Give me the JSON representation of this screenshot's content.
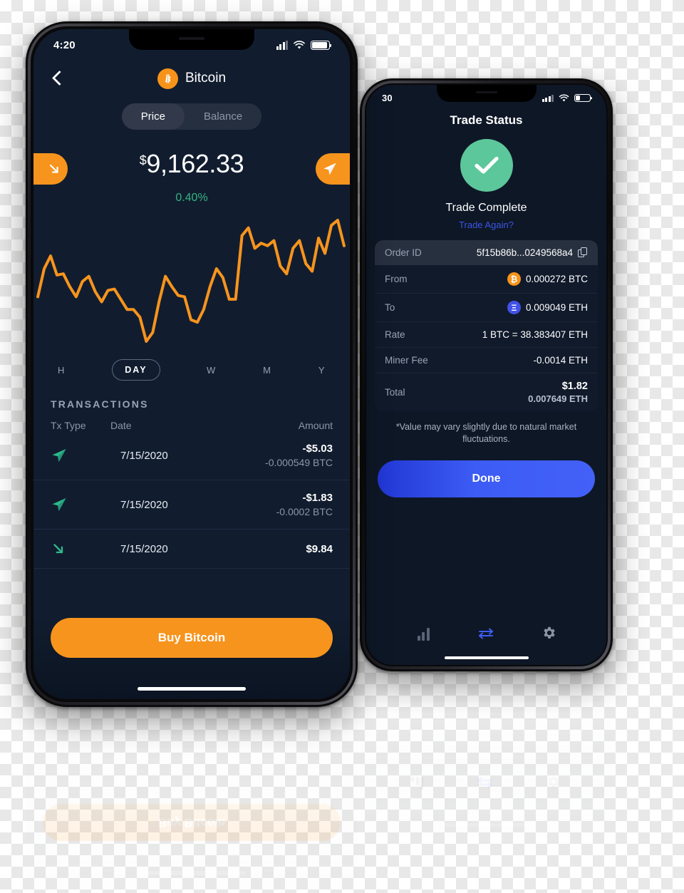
{
  "phone_front": {
    "status_bar": {
      "time": "4:20",
      "signal_icon": "signal-bars-icon",
      "wifi_icon": "wifi-icon",
      "battery_icon": "battery-icon",
      "battery_level_pct": 88
    },
    "nav": {
      "back_icon": "chevron-left-icon",
      "coin_icon": "bitcoin-icon",
      "coin_glyph": "₿",
      "title": "Bitcoin"
    },
    "segmented": {
      "option_price": "Price",
      "option_balance": "Balance",
      "selected": "Price"
    },
    "actions": {
      "receive_icon": "arrow-down-right-icon",
      "send_icon": "paper-plane-icon"
    },
    "price": {
      "currency_symbol": "$",
      "value": "9,162.33",
      "change": "0.40%",
      "change_color": "#34b57f"
    },
    "ranges": {
      "items": [
        "H",
        "DAY",
        "W",
        "M",
        "Y"
      ],
      "selected": "DAY"
    },
    "transactions": {
      "section_title": "TRANSACTIONS",
      "columns": [
        "Tx Type",
        "Date",
        "Amount"
      ],
      "rows": [
        {
          "type_icon": "paper-plane-icon",
          "direction": "sent",
          "date": "7/15/2020",
          "amount": "-$5.03",
          "crypto": "-0.000549 BTC"
        },
        {
          "type_icon": "paper-plane-icon",
          "direction": "sent",
          "date": "7/15/2020",
          "amount": "-$1.83",
          "crypto": "-0.0002 BTC"
        },
        {
          "type_icon": "arrow-down-right-icon",
          "direction": "received",
          "date": "7/15/2020",
          "amount": "$9.84",
          "crypto": ""
        }
      ]
    },
    "buy_button": "Buy Bitcoin",
    "accent_color": "#f7941d",
    "screen_bg": "#111d2f"
  },
  "phone_back": {
    "status_bar": {
      "time": "30",
      "signal_icon": "signal-bars-icon",
      "wifi_icon": "wifi-icon",
      "battery_icon": "battery-icon",
      "battery_level_pct": 35
    },
    "title": "Trade Status",
    "status_icon": "check-circle-icon",
    "status_color": "#5cc79a",
    "status_text": "Trade Complete",
    "trade_again_link": "Trade Again?",
    "details": [
      {
        "label": "Order ID",
        "value": "5f15b86b...0249568a4",
        "icon": "copy-icon",
        "highlight": true
      },
      {
        "label": "From",
        "value": "0.000272 BTC",
        "coin_icon": "bitcoin-icon",
        "coin_glyph": "₿"
      },
      {
        "label": "To",
        "value": "0.009049 ETH",
        "coin_icon": "ethereum-icon",
        "coin_glyph": "Ξ"
      },
      {
        "label": "Rate",
        "value": "1 BTC = 38.383407 ETH"
      },
      {
        "label": "Miner Fee",
        "value": "-0.0014 ETH"
      },
      {
        "label": "Total",
        "value": "$1.82",
        "sub_value": "0.007649 ETH"
      }
    ],
    "note": "*Value may vary slightly due to natural market fluctuations.",
    "done_button": "Done",
    "tab_bar": [
      {
        "icon": "bar-chart-icon",
        "active": false
      },
      {
        "icon": "exchange-arrows-icon",
        "active": true
      },
      {
        "icon": "gear-icon",
        "active": false
      }
    ],
    "accent_color": "#3d5cf5"
  },
  "chart_data": {
    "type": "line",
    "title": "",
    "xlabel": "",
    "ylabel": "",
    "line_color": "#f7941d",
    "grid": false,
    "legend": "none",
    "x": [
      0,
      1,
      2,
      3,
      4,
      5,
      6,
      7,
      8,
      9,
      10,
      11,
      12,
      13,
      14,
      15,
      16,
      17,
      18,
      19,
      20,
      21,
      22,
      23,
      24,
      25,
      26,
      27,
      28,
      29,
      30,
      31,
      32,
      33,
      34,
      35,
      36,
      37,
      38,
      39,
      40,
      41,
      42
    ],
    "values": [
      40,
      62,
      72,
      57,
      58,
      48,
      40,
      52,
      56,
      44,
      36,
      45,
      46,
      38,
      30,
      30,
      24,
      5,
      12,
      36,
      56,
      48,
      41,
      40,
      22,
      20,
      30,
      48,
      62,
      55,
      38,
      38,
      88,
      94,
      78,
      82,
      80,
      84,
      64,
      58,
      78,
      84,
      66,
      60,
      86,
      74,
      96,
      100,
      80
    ]
  }
}
